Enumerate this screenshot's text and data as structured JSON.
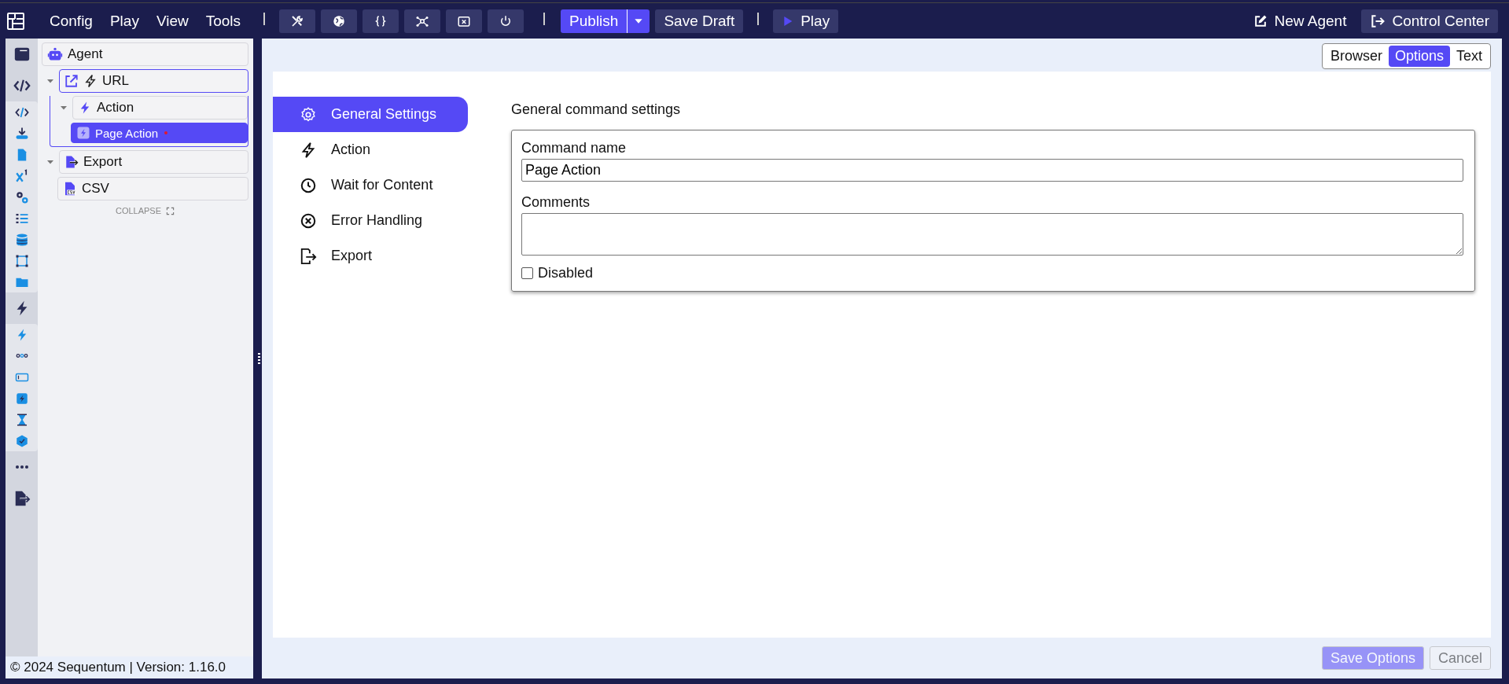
{
  "menu": [
    "Config",
    "Play",
    "View",
    "Tools"
  ],
  "toolbar_icons": [
    {
      "kind": "tools"
    },
    {
      "kind": "globe"
    },
    {
      "kind": "braces"
    },
    {
      "kind": "network"
    },
    {
      "kind": "close-box"
    },
    {
      "kind": "power"
    }
  ],
  "publish": "Publish",
  "save_draft": "Save Draft",
  "play": "Play",
  "new_agent": "New Agent",
  "control_center": "Control Center",
  "icon_rail": [
    {
      "kind": "window"
    },
    {
      "kind": "code",
      "children": [
        {
          "kind": "code-blue"
        },
        {
          "kind": "download"
        },
        {
          "kind": "file"
        },
        {
          "kind": "variable"
        },
        {
          "kind": "gears"
        },
        {
          "kind": "list"
        },
        {
          "kind": "database"
        },
        {
          "kind": "selection"
        },
        {
          "kind": "folder"
        }
      ]
    },
    {
      "kind": "bolt",
      "children": [
        {
          "kind": "bolt-blue"
        },
        {
          "kind": "dots-ring"
        },
        {
          "kind": "input"
        },
        {
          "kind": "bolt-square"
        },
        {
          "kind": "hourglass"
        },
        {
          "kind": "check-badge"
        }
      ]
    },
    {
      "kind": "more"
    },
    {
      "kind": "file-export"
    }
  ],
  "agent": "Agent",
  "tree": [
    {
      "label": "URL",
      "kind": "url",
      "expanded": true,
      "selected": false,
      "focused": true,
      "modified": false,
      "children": [
        {
          "label": "Action",
          "kind": "action",
          "expanded": true,
          "selected": false,
          "focused": false,
          "modified": false,
          "children": [
            {
              "label": "Page Action",
              "kind": "page-action",
              "selected": true,
              "focused": false,
              "modified": true
            }
          ]
        }
      ]
    },
    {
      "label": "Export",
      "kind": "export",
      "expanded": true,
      "selected": false,
      "focused": false,
      "modified": false,
      "children": [
        {
          "label": "CSV",
          "kind": "csv",
          "selected": false,
          "focused": false,
          "modified": false
        }
      ]
    }
  ],
  "collapse": "COLLAPSE",
  "copyright": "© 2024 Sequentum | Version: 1.16.0",
  "view_tabs": [
    {
      "label": "Browser",
      "selected": false
    },
    {
      "label": "Options",
      "selected": true
    },
    {
      "label": "Text",
      "selected": false
    }
  ],
  "settings_nav": [
    {
      "label": "General Settings",
      "kind": "gear",
      "selected": true
    },
    {
      "label": "Action",
      "kind": "bolt",
      "selected": false
    },
    {
      "label": "Wait for Content",
      "kind": "clock",
      "selected": false
    },
    {
      "label": "Error Handling",
      "kind": "error",
      "selected": false
    },
    {
      "label": "Export",
      "kind": "export",
      "selected": false
    }
  ],
  "form": {
    "title": "General command settings",
    "command_name": {
      "label": "Command name",
      "value": "Page Action"
    },
    "comments": {
      "label": "Comments"
    },
    "disabled": {
      "label": "Disabled",
      "checked": false
    }
  },
  "footer_buttons": [
    {
      "label": "Save Options",
      "kind": "primary",
      "disabled": true
    },
    {
      "label": "Cancel",
      "kind": "secondary",
      "disabled": true
    }
  ]
}
